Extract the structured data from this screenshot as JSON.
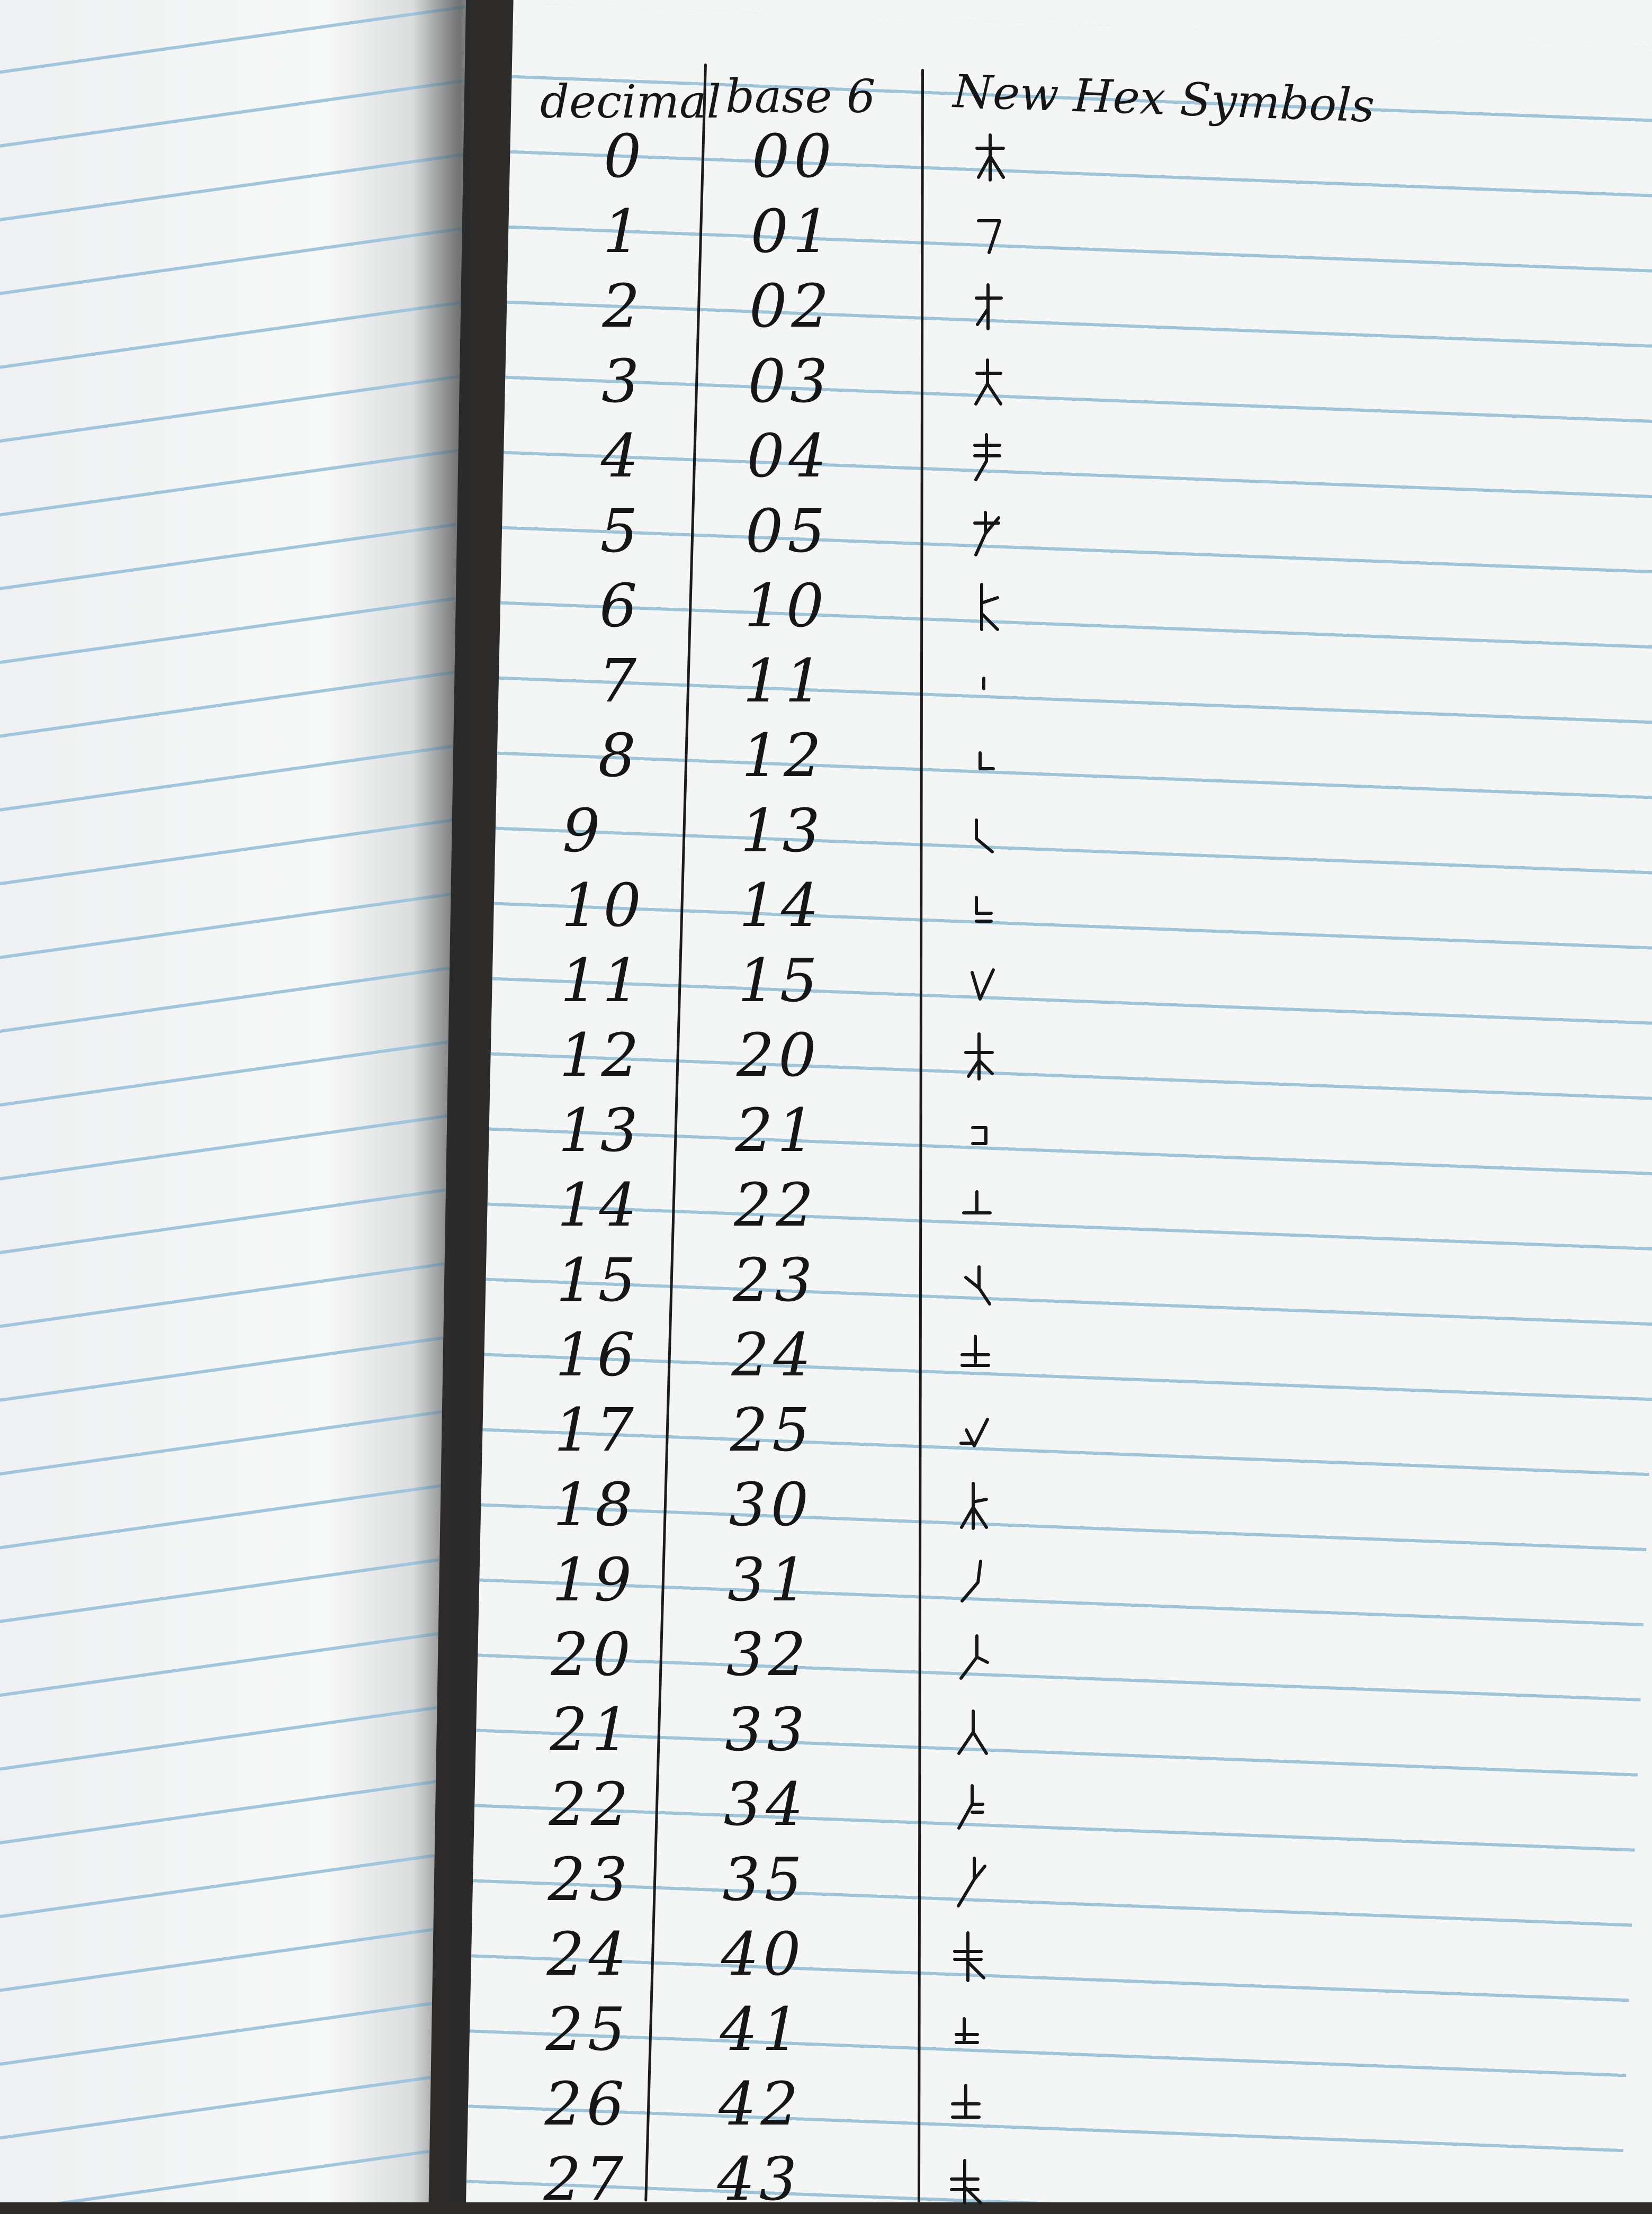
{
  "table": {
    "headers": {
      "decimal": "decimal",
      "base6": "base 6",
      "symbols": "New Hex Symbols"
    },
    "rows": [
      {
        "decimal": "0",
        "base6": "00"
      },
      {
        "decimal": "1",
        "base6": "01"
      },
      {
        "decimal": "2",
        "base6": "02"
      },
      {
        "decimal": "3",
        "base6": "03"
      },
      {
        "decimal": "4",
        "base6": "04"
      },
      {
        "decimal": "5",
        "base6": "05"
      },
      {
        "decimal": "6",
        "base6": "10"
      },
      {
        "decimal": "7",
        "base6": "11"
      },
      {
        "decimal": "8",
        "base6": "12"
      },
      {
        "decimal": "9",
        "base6": "13"
      },
      {
        "decimal": "10",
        "base6": "14"
      },
      {
        "decimal": "11",
        "base6": "15"
      },
      {
        "decimal": "12",
        "base6": "20"
      },
      {
        "decimal": "13",
        "base6": "21"
      },
      {
        "decimal": "14",
        "base6": "22"
      },
      {
        "decimal": "15",
        "base6": "23"
      },
      {
        "decimal": "16",
        "base6": "24"
      },
      {
        "decimal": "17",
        "base6": "25"
      },
      {
        "decimal": "18",
        "base6": "30"
      },
      {
        "decimal": "19",
        "base6": "31"
      },
      {
        "decimal": "20",
        "base6": "32"
      },
      {
        "decimal": "21",
        "base6": "33"
      },
      {
        "decimal": "22",
        "base6": "34"
      },
      {
        "decimal": "23",
        "base6": "35"
      },
      {
        "decimal": "24",
        "base6": "40"
      },
      {
        "decimal": "25",
        "base6": "41"
      },
      {
        "decimal": "26",
        "base6": "42"
      },
      {
        "decimal": "27",
        "base6": "43"
      }
    ]
  },
  "colors": {
    "ink": "#161616",
    "rule_line": "#8fbcd4",
    "paper": "#f4f5f5"
  }
}
